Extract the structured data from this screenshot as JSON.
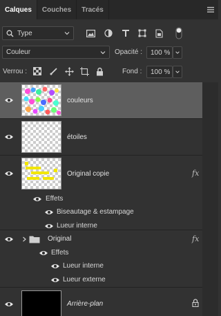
{
  "tabs": [
    {
      "label": "Calques",
      "active": true
    },
    {
      "label": "Couches",
      "active": false
    },
    {
      "label": "Tracés",
      "active": false
    }
  ],
  "filter": {
    "kind_label": "Type",
    "icons": [
      "image-filter-icon",
      "adjustment-filter-icon",
      "text-filter-icon",
      "shape-filter-icon",
      "smart-object-filter-icon",
      "filter-toggle-icon"
    ]
  },
  "blend": {
    "mode": "Couleur",
    "opacity_label": "Opacité :",
    "opacity_value": "100 %"
  },
  "lock": {
    "label": "Verrou :",
    "fill_label": "Fond :",
    "fill_value": "100 %"
  },
  "layers": [
    {
      "name": "couleurs",
      "selected": true,
      "thumb": "colors"
    },
    {
      "name": "étoiles",
      "selected": false,
      "thumb": "transparent"
    },
    {
      "name": "Original copie",
      "selected": false,
      "thumb": "yellow-text",
      "fx": "fx",
      "effects_label": "Effets",
      "effects": [
        "Biseautage & estampage",
        "Lueur interne"
      ]
    },
    {
      "name": "Original",
      "selected": false,
      "group": true,
      "fx": "fx",
      "effects_label": "Effets",
      "effects": [
        "Lueur interne",
        "Lueur externe"
      ]
    },
    {
      "name": "Arrière-plan",
      "selected": false,
      "thumb": "black",
      "locked": true
    }
  ],
  "colors": {
    "panel_bg": "#323232",
    "selected_row": "#5e5e5e",
    "tab_bar": "#282828"
  }
}
